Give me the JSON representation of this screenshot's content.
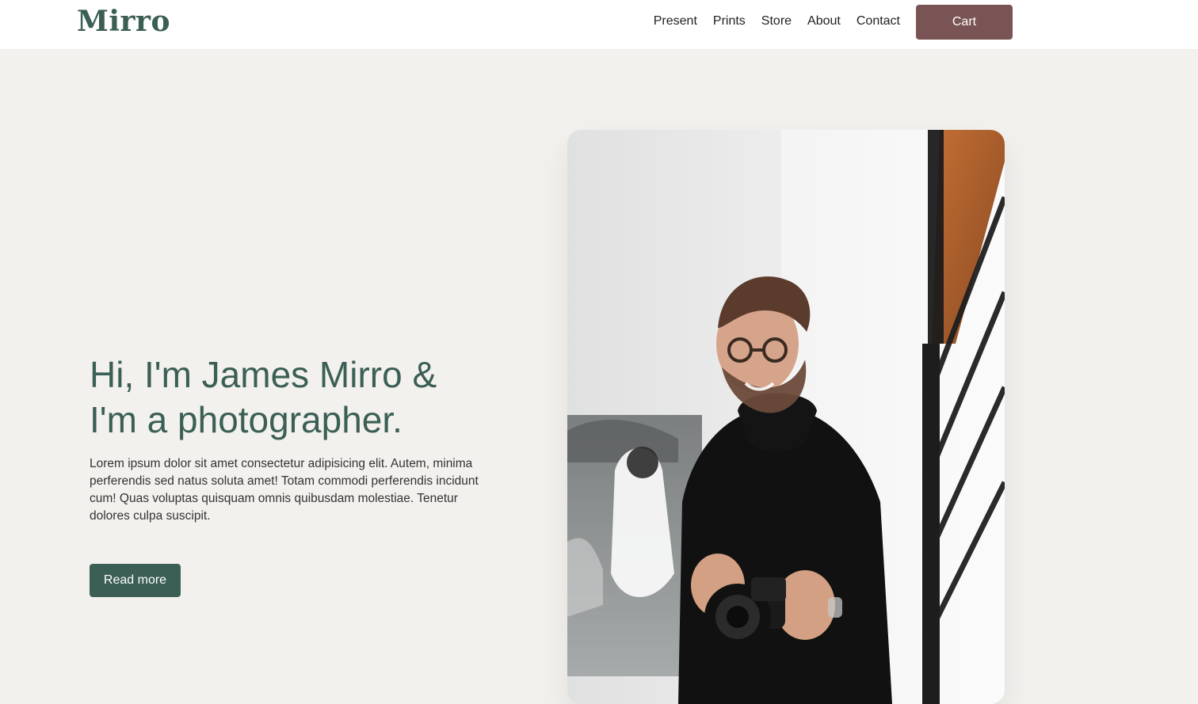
{
  "header": {
    "logo": "Mirro",
    "nav": [
      "Present",
      "Prints",
      "Store",
      "About",
      "Contact"
    ],
    "cart_label": "Cart"
  },
  "hero": {
    "title_line1": "Hi, I'm James Mirro &",
    "title_line2": "I'm a photographer.",
    "body": "Lorem ipsum dolor sit amet consectetur adipisicing elit. Autem, minima perferendis sed natus soluta amet! Totam commodi perferendis incidunt cum! Quas voluptas quisquam omnis quibusdam molestiae. Tenetur dolores culpa suscipit.",
    "cta_label": "Read more",
    "photo_description": "portrait-photo"
  },
  "colors": {
    "background": "#f3f1ee",
    "brand_green": "#3b5f55",
    "cart_brown": "#7a5454"
  }
}
